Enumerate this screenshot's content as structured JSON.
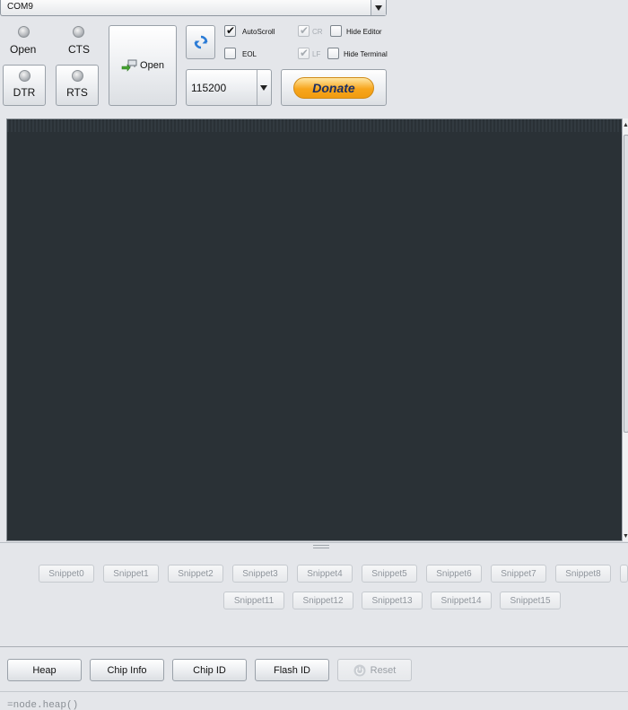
{
  "port": {
    "value": "COM9"
  },
  "leds": {
    "open": "Open",
    "cts": "CTS"
  },
  "buttons": {
    "dtr": "DTR",
    "rts": "RTS",
    "open": "Open",
    "donate": "Donate"
  },
  "baud": {
    "value": "115200"
  },
  "checks": {
    "autoscroll": {
      "label": "AutoScroll",
      "checked": true
    },
    "eol": {
      "label": "EOL",
      "checked": false
    },
    "cr": {
      "label": "CR",
      "checked": true,
      "disabled": true
    },
    "lf": {
      "label": "LF",
      "checked": true,
      "disabled": true
    },
    "hide_editor": {
      "label": "Hide Editor",
      "checked": false
    },
    "hide_terminal": {
      "label": "Hide Terminal",
      "checked": false
    }
  },
  "snippets": {
    "row1": [
      "Snippet0",
      "Snippet1",
      "Snippet2",
      "Snippet3",
      "Snippet4",
      "Snippet5",
      "Snippet6",
      "Snippet7",
      "Snippet8"
    ],
    "row2": [
      "Snippet11",
      "Snippet12",
      "Snippet13",
      "Snippet14",
      "Snippet15"
    ]
  },
  "actions": {
    "heap": "Heap",
    "chip_info": "Chip Info",
    "chip_id": "Chip ID",
    "flash_id": "Flash ID",
    "reset": "Reset"
  },
  "command": {
    "text": "=node.heap()"
  },
  "colors": {
    "terminal_bg": "#2a3136",
    "donate_orange": "#f7a51c",
    "refresh_blue": "#2a7bd6"
  }
}
